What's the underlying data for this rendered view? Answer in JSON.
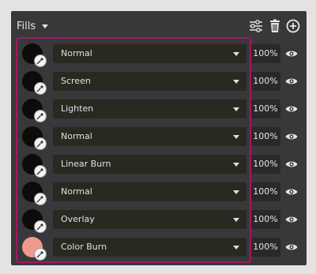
{
  "header": {
    "title": "Fills",
    "icons": [
      "adjust-sliders-icon",
      "trash-icon",
      "add-circle-icon"
    ]
  },
  "colors": {
    "panel": "#38383a",
    "row_background": "#292821",
    "selection_border": "#a0195f",
    "swatch_dark": "#0c0c08",
    "swatch_salmon": "#ef9a8b"
  },
  "fills": [
    {
      "blend_mode": "Normal",
      "opacity": "100%",
      "swatch_color": "#0c0c08"
    },
    {
      "blend_mode": "Screen",
      "opacity": "100%",
      "swatch_color": "#0c0c08"
    },
    {
      "blend_mode": "Lighten",
      "opacity": "100%",
      "swatch_color": "#0c0c08"
    },
    {
      "blend_mode": "Normal",
      "opacity": "100%",
      "swatch_color": "#0c0c08"
    },
    {
      "blend_mode": "Linear Burn",
      "opacity": "100%",
      "swatch_color": "#0c0c08"
    },
    {
      "blend_mode": "Normal",
      "opacity": "100%",
      "swatch_color": "#0c0c08"
    },
    {
      "blend_mode": "Overlay",
      "opacity": "100%",
      "swatch_color": "#0c0c08"
    },
    {
      "blend_mode": "Color Burn",
      "opacity": "100%",
      "swatch_color": "#ef9a8b"
    }
  ]
}
